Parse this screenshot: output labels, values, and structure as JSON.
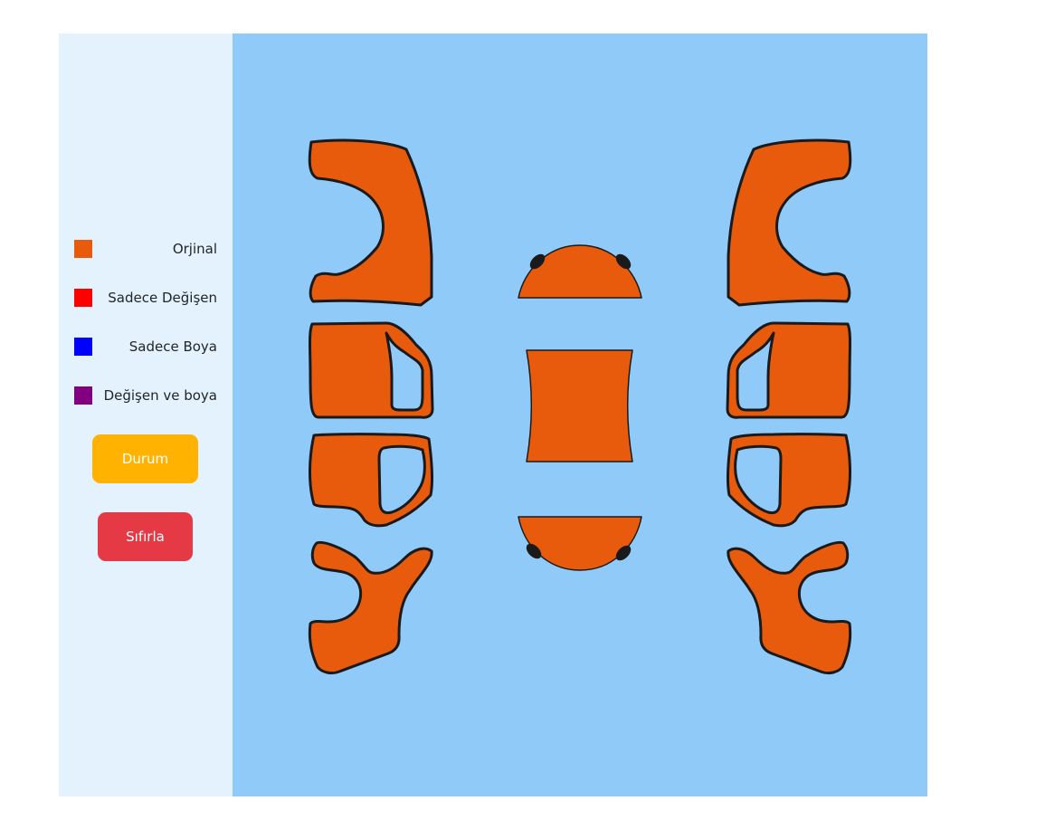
{
  "legend": [
    {
      "label": "Orjinal",
      "color": "#e95b0c"
    },
    {
      "label": "Sadece Değişen",
      "color": "#ff0000"
    },
    {
      "label": "Sadece Boya",
      "color": "#0000ff"
    },
    {
      "label": "Değişen ve boya",
      "color": "#800080"
    }
  ],
  "buttons": {
    "status_label": "Durum",
    "status_color": "#ffb300",
    "reset_label": "Sıfırla",
    "reset_color": "#e63946"
  },
  "colors": {
    "sidebar_bg": "#e3f2fd",
    "car_area_bg": "#90caf9",
    "panel_stroke": "#1a1a1a"
  },
  "car_panels": [
    {
      "name": "left-front-fender",
      "status": "Orjinal"
    },
    {
      "name": "left-front-door",
      "status": "Orjinal"
    },
    {
      "name": "left-rear-door",
      "status": "Orjinal"
    },
    {
      "name": "left-rear-fender",
      "status": "Orjinal"
    },
    {
      "name": "front-bumper",
      "status": "Orjinal"
    },
    {
      "name": "roof",
      "status": "Orjinal"
    },
    {
      "name": "rear-bumper",
      "status": "Orjinal"
    },
    {
      "name": "right-front-fender",
      "status": "Orjinal"
    },
    {
      "name": "right-front-door",
      "status": "Orjinal"
    },
    {
      "name": "right-rear-door",
      "status": "Orjinal"
    },
    {
      "name": "right-rear-fender",
      "status": "Orjinal"
    }
  ]
}
